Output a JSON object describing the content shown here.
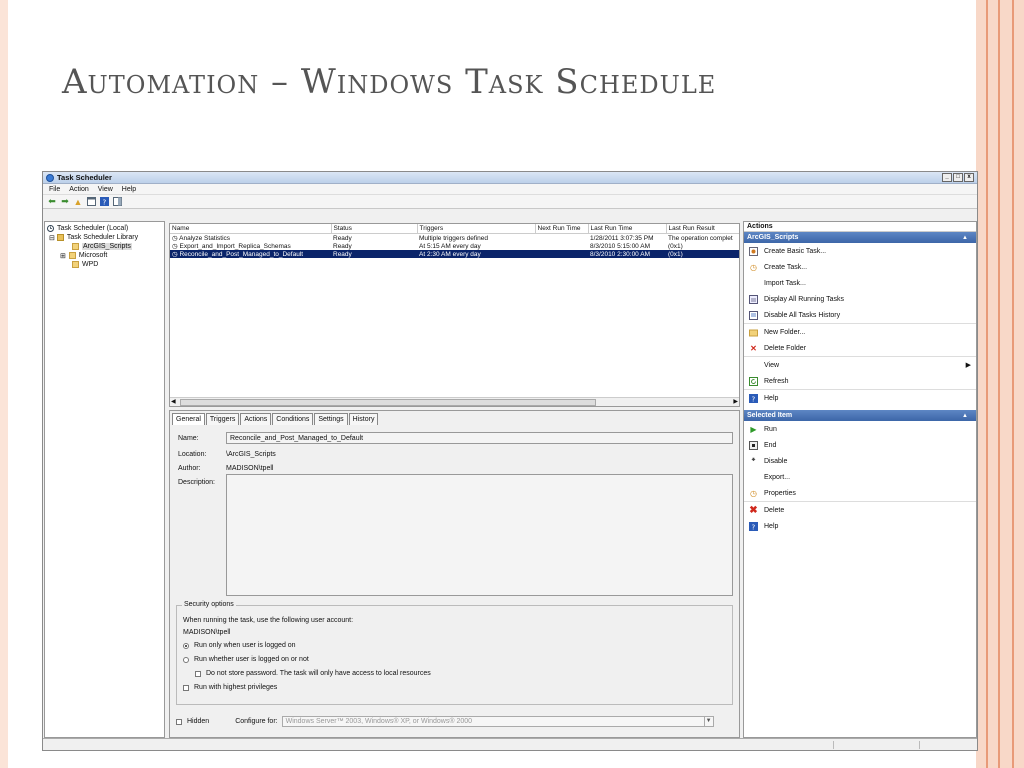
{
  "slide": {
    "title": "Automation – Windows Task Schedule"
  },
  "window": {
    "title": "Task Scheduler",
    "controls": [
      "_",
      "□",
      "x"
    ]
  },
  "menu": [
    "File",
    "Action",
    "View",
    "Help"
  ],
  "tree": {
    "root": "Task Scheduler (Local)",
    "library": "Task Scheduler Library",
    "children": [
      "ArcGIS_Scripts",
      "Microsoft",
      "WPD"
    ],
    "expand_marker": "⊞",
    "collapse_marker": "⊟"
  },
  "task_list": {
    "columns": [
      "Name",
      "Status",
      "Triggers",
      "Next Run Time",
      "Last Run Time",
      "Last Run Result"
    ],
    "rows": [
      {
        "name": "Analyze Statistics",
        "status": "Ready",
        "triggers": "Multiple triggers defined",
        "next": "",
        "last": "1/28/2011 3:07:35 PM",
        "result": "The operation complet"
      },
      {
        "name": "Export_and_Import_Replica_Schemas",
        "status": "Ready",
        "triggers": "At 5:15 AM every day",
        "next": "",
        "last": "8/3/2010 5:15:00 AM",
        "result": "(0x1)"
      },
      {
        "name": "Reconcile_and_Post_Managed_to_Default",
        "status": "Ready",
        "triggers": "At 2:30 AM every day",
        "next": "",
        "last": "8/3/2010 2:30:00 AM",
        "result": "(0x1)"
      }
    ],
    "selected_row": 2
  },
  "tabs": [
    "General",
    "Triggers",
    "Actions",
    "Conditions",
    "Settings",
    "History"
  ],
  "general": {
    "name_label": "Name:",
    "name_value": "Reconcile_and_Post_Managed_to_Default",
    "location_label": "Location:",
    "location_value": "\\ArcGIS_Scripts",
    "author_label": "Author:",
    "author_value": "MADISON\\tpell",
    "description_label": "Description:",
    "security_legend": "Security options",
    "security_text": "When running the task, use the following user account:",
    "account": "MADISON\\tpell",
    "opt_logged_on": "Run only when user is logged on",
    "opt_whether": "Run whether user is logged on or not",
    "opt_no_store": "Do not store password.  The task will only have access to local resources",
    "opt_highest": "Run with highest privileges",
    "hidden_label": "Hidden",
    "configure_label": "Configure for:",
    "configure_value": "Windows Server™ 2003, Windows® XP, or Windows® 2000"
  },
  "actions_pane": {
    "header": "Actions",
    "group1_title": "ArcGIS_Scripts",
    "group1": [
      "Create Basic Task...",
      "Create Task...",
      "Import Task...",
      "Display All Running Tasks",
      "Disable All Tasks History",
      "New Folder...",
      "Delete Folder",
      "View",
      "Refresh",
      "Help"
    ],
    "group2_title": "Selected Item",
    "group2": [
      "Run",
      "End",
      "Disable",
      "Export...",
      "Properties",
      "Delete",
      "Help"
    ],
    "collapse_glyph": "▲",
    "submenu_glyph": "▶"
  }
}
